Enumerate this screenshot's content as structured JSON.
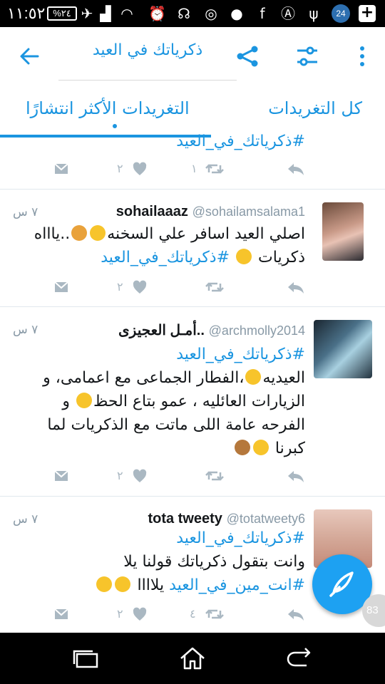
{
  "status_bar": {
    "time": "١١:٥٢",
    "battery": "%٢٤",
    "notification_count": "24"
  },
  "header": {
    "search_query": "ذكرياتك في العيد"
  },
  "tabs": [
    {
      "label": "كل التغريدات"
    },
    {
      "label": "التغريدات الأكثر انتشارًا"
    }
  ],
  "tweets": [
    {
      "lines": [
        "#ذكرياتك_في_العيد"
      ],
      "likes": "٢",
      "retweets": "١"
    },
    {
      "name": "sohailaaaz",
      "handle": "@sohailamsalama1",
      "time": "٧ س",
      "line1": "اصلي العيد اسافر علي السخنه",
      "line1b": "..ياااه",
      "line2a": "ذكريات",
      "line2b": "#ذكرياتك_في_العيد",
      "likes": "٢",
      "retweets": ""
    },
    {
      "name": "أمـل العجيزى..",
      "handle": "@archmolly2014",
      "time": "٧ س",
      "line1": "#ذكرياتك_في_العيد",
      "line2": "العيديه",
      "line2b": "،الفطار الجماعى مع اعمامى، و",
      "line3": "الزيارات العائليه ، عمو بتاع الحظ",
      "line3b": "و",
      "line4": "الفرحه عامة اللى ماتت مع الذكريات لما",
      "line5": "كبرنا",
      "likes": "٢",
      "retweets": ""
    },
    {
      "name": "tota tweety",
      "handle": "@totatweety6",
      "time": "٧ س",
      "line1": "#ذكرياتك_في_العيد",
      "line2": "وانت بتقول ذكرياتك قولنا يلا",
      "line3a": "#انت_مين_في_العيد",
      "line3b": "يلاااا",
      "likes": "٢",
      "retweets": "٤"
    }
  ],
  "unread_badge": "83",
  "colors": {
    "accent": "#1b95e0",
    "fab": "#1da1f2",
    "muted": "#aab8c2"
  }
}
